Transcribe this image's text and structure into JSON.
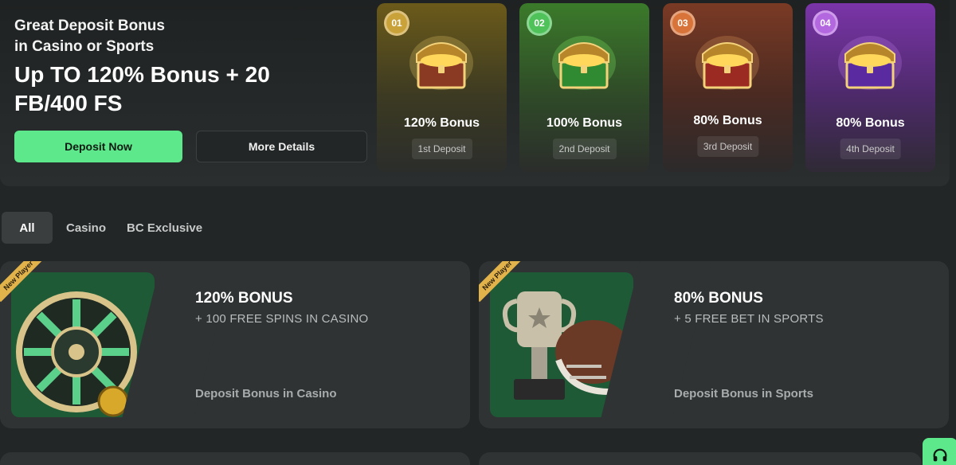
{
  "hero": {
    "subtitle_line1": "Great Deposit Bonus",
    "subtitle_line2": "in Casino or Sports",
    "title_line1": "Up TO 120% Bonus + 20",
    "title_line2": "FB/400 FS",
    "deposit_button": "Deposit Now",
    "details_button": "More Details"
  },
  "tiers": [
    {
      "number": "01",
      "bonus": "120% Bonus",
      "deposit": "1st Deposit",
      "accent": "#c9a23a"
    },
    {
      "number": "02",
      "bonus": "100% Bonus",
      "deposit": "2nd Deposit",
      "accent": "#4fc25a"
    },
    {
      "number": "03",
      "bonus": "80% Bonus",
      "deposit": "3rd Deposit",
      "accent": "#d8743a"
    },
    {
      "number": "04",
      "bonus": "80% Bonus",
      "deposit": "4th Deposit",
      "accent": "#b468e0"
    }
  ],
  "tabs": [
    "All",
    "Casino",
    "BC Exclusive"
  ],
  "promos": [
    {
      "ribbon": "New Player",
      "title": "120% BONUS",
      "desc": "+ 100 FREE SPINS IN CASINO",
      "category": "Deposit Bonus in Casino"
    },
    {
      "ribbon": "New Player",
      "title": "80% BONUS",
      "desc": "+ 5 FREE BET IN SPORTS",
      "category": "Deposit Bonus in Sports"
    }
  ],
  "colors": {
    "accent_green": "#5ee88c",
    "background": "#232626",
    "card": "#2f3333"
  }
}
